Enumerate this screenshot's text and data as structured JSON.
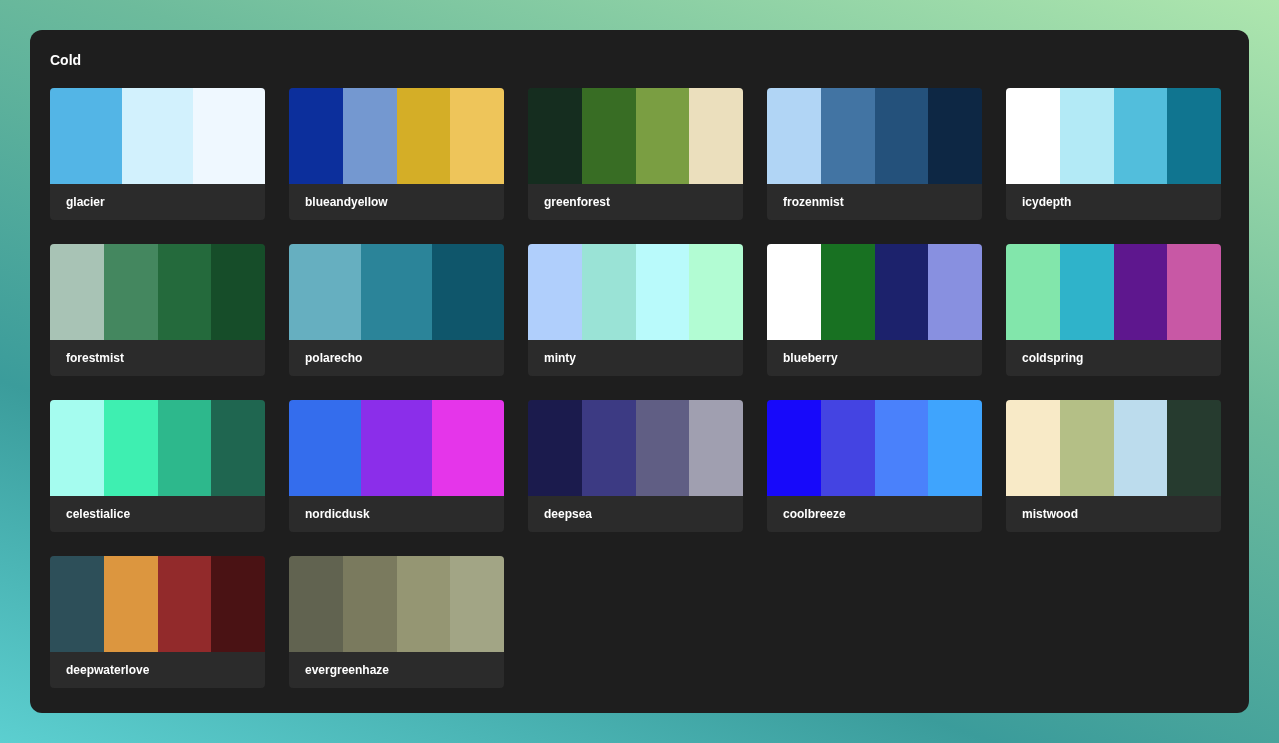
{
  "title": "Cold",
  "palettes": [
    {
      "name": "glacier",
      "colors": [
        {
          "color": "#53b5e6"
        },
        {
          "color": "#d2f1fd"
        },
        {
          "color": "#eff8ff"
        }
      ]
    },
    {
      "name": "blueandyellow",
      "colors": [
        {
          "color": "#0c2f9c"
        },
        {
          "color": "#7498d0"
        },
        {
          "color": "#d4ae27"
        },
        {
          "color": "#eec55a"
        }
      ]
    },
    {
      "name": "greenforest",
      "colors": [
        {
          "color": "#152d1f"
        },
        {
          "color": "#386d24"
        },
        {
          "color": "#7a9e42"
        },
        {
          "color": "#ebdfbd"
        }
      ]
    },
    {
      "name": "frozenmist",
      "colors": [
        {
          "color": "#b1d5f5"
        },
        {
          "color": "#4274a3"
        },
        {
          "color": "#24517b"
        },
        {
          "color": "#0d2744"
        }
      ]
    },
    {
      "name": "icydepth",
      "colors": [
        {
          "color": "#ffffff"
        },
        {
          "color": "#b3eaf6"
        },
        {
          "color": "#52bedc"
        },
        {
          "color": "#107590"
        }
      ]
    },
    {
      "name": "forestmist",
      "colors": [
        {
          "color": "#a8c3b5"
        },
        {
          "color": "#44875f"
        },
        {
          "color": "#246a3c"
        },
        {
          "color": "#164d29"
        }
      ]
    },
    {
      "name": "polarecho",
      "colors": [
        {
          "color": "#66afc0"
        },
        {
          "color": "#2b8499"
        },
        {
          "color": "#0f566b"
        }
      ]
    },
    {
      "name": "minty",
      "colors": [
        {
          "color": "#b0cffc"
        },
        {
          "color": "#9ae3d6"
        },
        {
          "color": "#b9fafb"
        },
        {
          "color": "#b2fcd3"
        }
      ]
    },
    {
      "name": "blueberry",
      "colors": [
        {
          "color": "#ffffff"
        },
        {
          "color": "#187122"
        },
        {
          "color": "#1c226c"
        },
        {
          "color": "#8890e0"
        }
      ]
    },
    {
      "name": "coldspring",
      "colors": [
        {
          "color": "#82e6ab"
        },
        {
          "color": "#2fb3ca"
        },
        {
          "color": "#5e178e"
        },
        {
          "color": "#c858a5"
        }
      ]
    },
    {
      "name": "celestialice",
      "colors": [
        {
          "color": "#a5fcef"
        },
        {
          "color": "#3eefb1"
        },
        {
          "color": "#2db88c"
        },
        {
          "color": "#1f6650"
        }
      ]
    },
    {
      "name": "nordicdusk",
      "colors": [
        {
          "color": "#346ded"
        },
        {
          "color": "#8b2eea"
        },
        {
          "color": "#e535ea"
        }
      ]
    },
    {
      "name": "deepsea",
      "colors": [
        {
          "color": "#1b1b4d"
        },
        {
          "color": "#3c3a83"
        },
        {
          "color": "#605e84"
        },
        {
          "color": "#a09fb0"
        }
      ]
    },
    {
      "name": "coolbreeze",
      "colors": [
        {
          "color": "#1709fa"
        },
        {
          "color": "#4444e2"
        },
        {
          "color": "#4a81fb"
        },
        {
          "color": "#3fa4fd"
        }
      ]
    },
    {
      "name": "mistwood",
      "colors": [
        {
          "color": "#f8eac7"
        },
        {
          "color": "#b4bf86"
        },
        {
          "color": "#bcdced"
        },
        {
          "color": "#263b2f"
        }
      ]
    },
    {
      "name": "deepwaterlove",
      "colors": [
        {
          "color": "#2d4f59"
        },
        {
          "color": "#dc963f"
        },
        {
          "color": "#922a2b"
        },
        {
          "color": "#4a1214"
        }
      ]
    },
    {
      "name": "evergreenhaze",
      "colors": [
        {
          "color": "#616350"
        },
        {
          "color": "#7a7a5e"
        },
        {
          "color": "#959673"
        },
        {
          "color": "#a2a585"
        }
      ]
    }
  ]
}
